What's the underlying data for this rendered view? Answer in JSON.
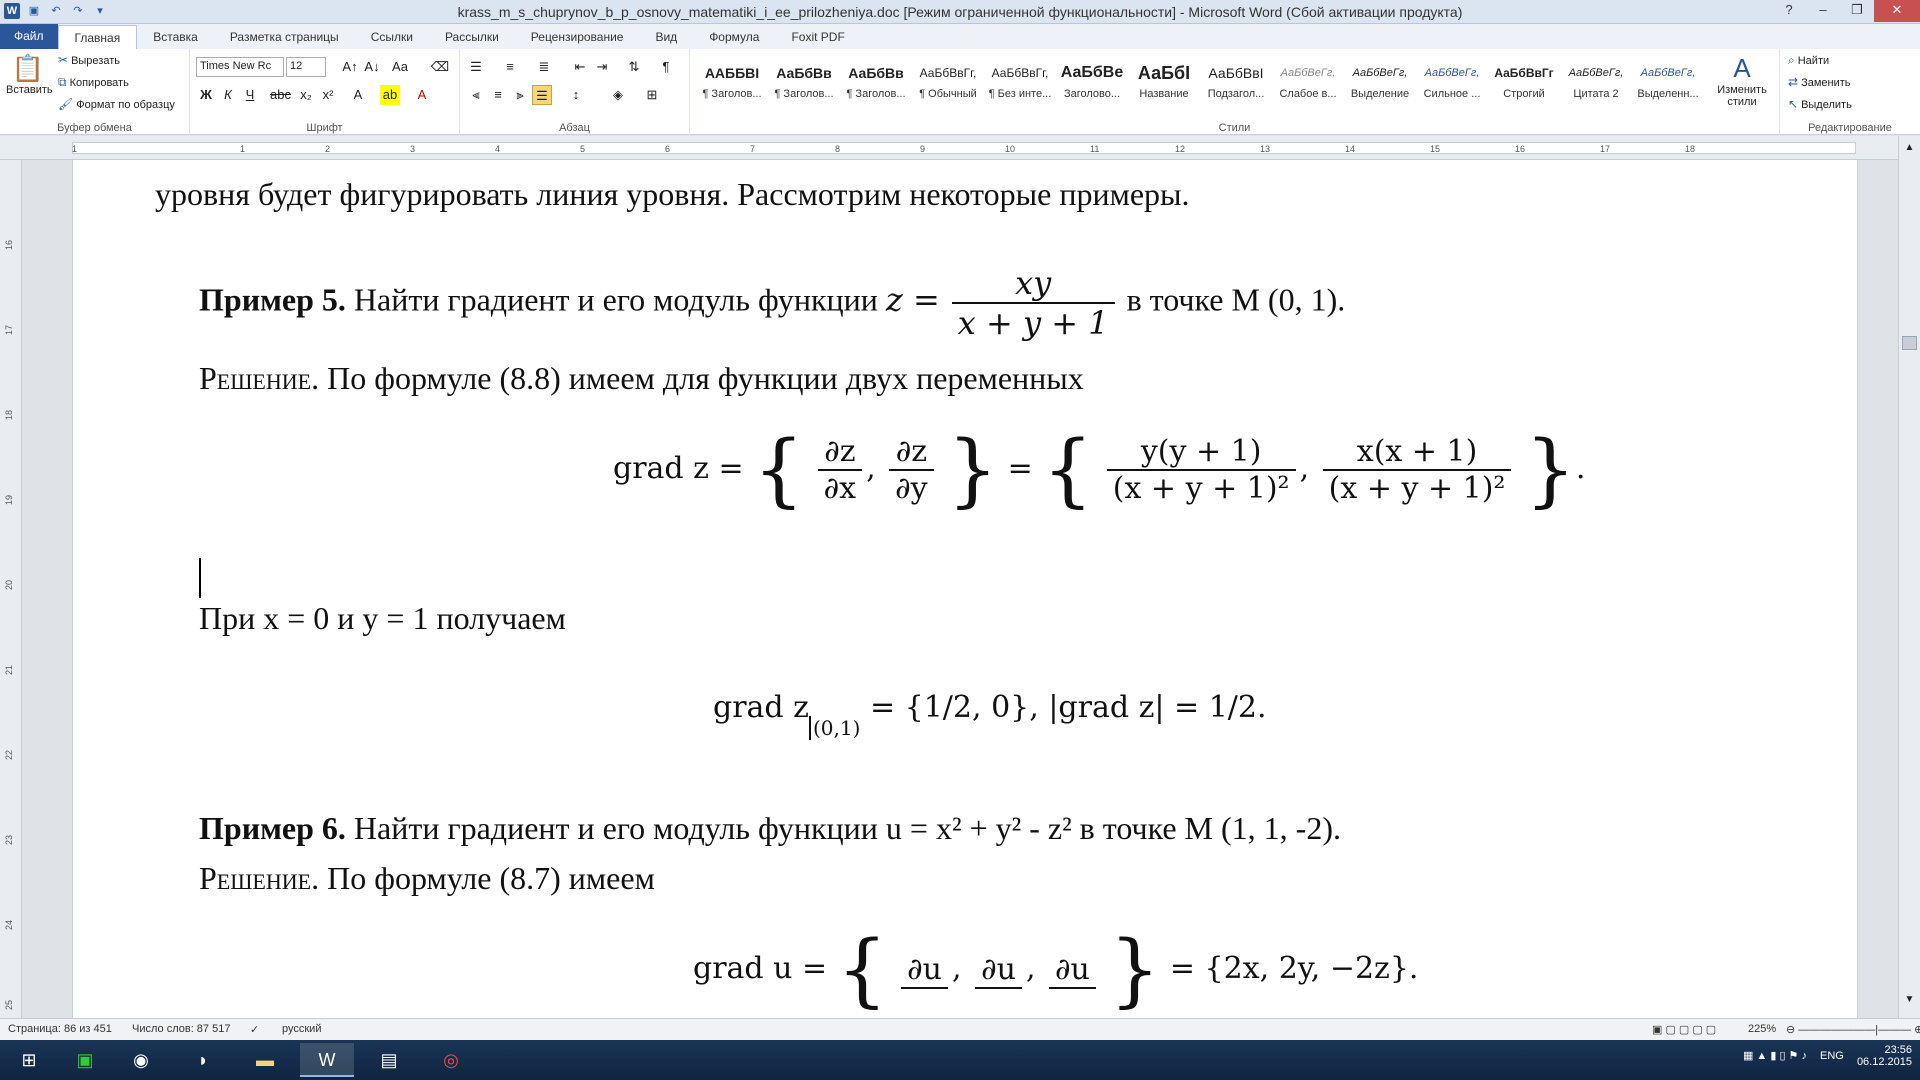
{
  "window": {
    "title": "krass_m_s_chuprynov_b_p_osnovy_matematiki_i_ee_prilozheniya.doc [Режим ограниченной функциональности] - Microsoft Word (Сбой активации продукта)",
    "qat_icons": [
      "word-logo-icon",
      "save-icon",
      "undo-icon",
      "redo-icon",
      "customize-icon"
    ]
  },
  "tabs": [
    "Файл",
    "Главная",
    "Вставка",
    "Разметка страницы",
    "Ссылки",
    "Рассылки",
    "Рецензирование",
    "Вид",
    "Формула",
    "Foxit PDF"
  ],
  "ribbon": {
    "clipboard": {
      "paste": "Вставить",
      "cut": "Вырезать",
      "copy": "Копировать",
      "format_painter": "Формат по образцу",
      "label": "Буфер обмена"
    },
    "font": {
      "name": "Times New Rc",
      "size": "12",
      "label": "Шрифт"
    },
    "paragraph": {
      "label": "Абзац"
    },
    "styles": {
      "label": "Стили",
      "items": [
        {
          "preview": "ААББВІ",
          "name": "¶ Заголов..."
        },
        {
          "preview": "АаБбВв",
          "name": "¶ Заголов..."
        },
        {
          "preview": "АаБбВв",
          "name": "¶ Заголов..."
        },
        {
          "preview": "АаБбВвГг,",
          "name": "¶ Обычный"
        },
        {
          "preview": "АаБбВвГг,",
          "name": "¶ Без инте..."
        },
        {
          "preview": "АаБбВе",
          "name": "Заголово..."
        },
        {
          "preview": "АаБбІ",
          "name": "Название"
        },
        {
          "preview": "АаБбВвІ",
          "name": "Подзагол..."
        },
        {
          "preview": "АаБбВеГг,",
          "name": "Слабое в..."
        },
        {
          "preview": "АаБбВеГг,",
          "name": "Выделение"
        },
        {
          "preview": "АаБбВеГг,",
          "name": "Сильное ..."
        },
        {
          "preview": "АаБбВвГг",
          "name": "Строгий"
        },
        {
          "preview": "АаБбВеГг,",
          "name": "Цитата 2"
        },
        {
          "preview": "АаБбВеГг,",
          "name": "Выделенн..."
        }
      ],
      "change": "Изменить стили"
    },
    "editing": {
      "find": "Найти",
      "replace": "Заменить",
      "select": "Выделить",
      "label": "Редактирование"
    }
  },
  "ruler": {
    "h": [
      "1",
      "1",
      "2",
      "3",
      "4",
      "5",
      "6",
      "7",
      "8",
      "9",
      "10",
      "11",
      "12",
      "13",
      "14",
      "15",
      "16",
      "17",
      "18"
    ],
    "v": [
      "16",
      "17",
      "18",
      "19",
      "20",
      "21",
      "22",
      "23",
      "24",
      "25"
    ]
  },
  "document": {
    "line1": "уровня будет фигурировать линия уровня. Рассмотрим некоторые примеры.",
    "ex5_label": "Пример 5.",
    "ex5_text": "Найти градиент и его модуль функции",
    "ex5_func_lhs": "z =",
    "ex5_num": "xy",
    "ex5_den": "x + y + 1",
    "ex5_point": "в точке M (0, 1).",
    "sol_label": "Решение",
    "sol1_text": ". По формуле (8.8) имеем для функции двух переменных",
    "eq1_lhs": "grad z =",
    "eq1_d1_num": "∂z",
    "eq1_d1_den": "∂x",
    "eq1_d2_num": "∂z",
    "eq1_d2_den": "∂y",
    "eq1_f1_num": "y(y + 1)",
    "eq1_f1_den": "(x + y + 1)²",
    "eq1_f2_num": "x(x + 1)",
    "eq1_f2_den": "(x + y + 1)²",
    "pri_text": "При x = 0 и y = 1 получаем",
    "eq2_lhs": "grad z",
    "eq2_sub": "(0,1)",
    "eq2_rhs": "= {1/2, 0},     |grad z| = 1/2.",
    "ex6_label": "Пример 6.",
    "ex6_text": "Найти градиент и его модуль функции",
    "ex6_func": "u = x² + y² - z² в точке M (1, 1, -2).",
    "sol2_text": ". По формуле (8.7) имеем",
    "eq3_lhs": "grad u =",
    "eq3_d_num": "∂u",
    "eq3_rhs": "= {2x, 2y, −2z}."
  },
  "status": {
    "page": "Страница: 86 из 451",
    "words": "Число слов: 87 517",
    "lang": "русский",
    "zoom": "225%"
  },
  "tray": {
    "lang": "ENG",
    "time": "23:56",
    "date": "06.12.2015"
  }
}
